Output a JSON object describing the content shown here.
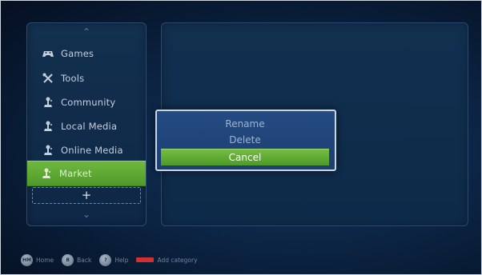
{
  "sidebar": {
    "items": [
      {
        "label": "Games",
        "icon": "gamepad-icon"
      },
      {
        "label": "Tools",
        "icon": "tools-icon"
      },
      {
        "label": "Community",
        "icon": "joystick-icon"
      },
      {
        "label": "Local Media",
        "icon": "joystick-icon"
      },
      {
        "label": "Online Media",
        "icon": "joystick-icon"
      },
      {
        "label": "Market",
        "icon": "joystick-icon"
      }
    ],
    "add_label": "+",
    "selected_index": 5
  },
  "dialog": {
    "rename": "Rename",
    "delete": "Delete",
    "cancel": "Cancel"
  },
  "footer": {
    "hints": [
      {
        "key": "HM",
        "label": "Home"
      },
      {
        "key": "B",
        "label": "Back"
      },
      {
        "key": "?",
        "label": "Help"
      }
    ],
    "red_label": "Add category"
  },
  "colors": {
    "accent_green": "#5aa832",
    "dialog_blue": "#22477c",
    "background": "#0b2140"
  }
}
